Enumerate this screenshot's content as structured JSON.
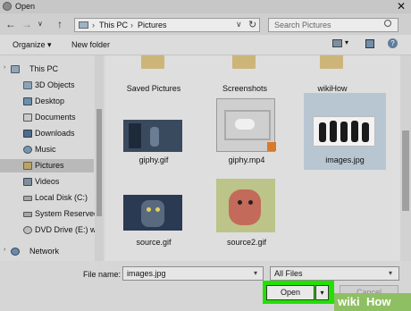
{
  "window": {
    "title": "Open",
    "close_label": "✕"
  },
  "nav": {
    "back": "←",
    "forward": "→",
    "recent": "∨",
    "up": "↑",
    "address": {
      "crumbs": [
        "This PC",
        "Pictures"
      ],
      "separator": "›"
    },
    "refresh": "↻",
    "dropdown": "∨"
  },
  "search": {
    "placeholder": "Search Pictures"
  },
  "toolbar": {
    "organize": "Organize ▾",
    "new_folder": "New folder",
    "help": "?"
  },
  "sidebar": {
    "items": [
      {
        "label": "This PC",
        "icon": "pc-icon"
      },
      {
        "label": "3D Objects",
        "icon": "cube-icon"
      },
      {
        "label": "Desktop",
        "icon": "desktop-icon"
      },
      {
        "label": "Documents",
        "icon": "documents-icon"
      },
      {
        "label": "Downloads",
        "icon": "download-icon"
      },
      {
        "label": "Music",
        "icon": "music-icon"
      },
      {
        "label": "Pictures",
        "icon": "pictures-icon",
        "selected": true
      },
      {
        "label": "Videos",
        "icon": "videos-icon"
      },
      {
        "label": "Local Disk (C:)",
        "icon": "disk-icon"
      },
      {
        "label": "System Reserved",
        "icon": "disk-icon"
      },
      {
        "label": "DVD Drive (E:) w",
        "icon": "dvd-icon"
      },
      {
        "label": "Network",
        "icon": "network-icon"
      }
    ]
  },
  "files": [
    {
      "name": "Saved Pictures",
      "kind": "folder"
    },
    {
      "name": "Screenshots",
      "kind": "folder"
    },
    {
      "name": "wikiHow",
      "kind": "folder"
    },
    {
      "name": "giphy.gif",
      "kind": "image"
    },
    {
      "name": "giphy.mp4",
      "kind": "video"
    },
    {
      "name": "images.jpg",
      "kind": "image",
      "selected": true
    },
    {
      "name": "source.gif",
      "kind": "image"
    },
    {
      "name": "source2.gif",
      "kind": "image"
    }
  ],
  "bottom": {
    "file_name_label": "File name:",
    "file_name_value": "images.jpg",
    "filter_value": "All Files",
    "open_label": "Open",
    "open_dropdown": "▾",
    "cancel_label": "Cancel"
  },
  "watermark": {
    "part1": "wiki",
    "part2": "How"
  },
  "colors": {
    "highlight": "#22e000",
    "selection": "#b8c6d2"
  }
}
